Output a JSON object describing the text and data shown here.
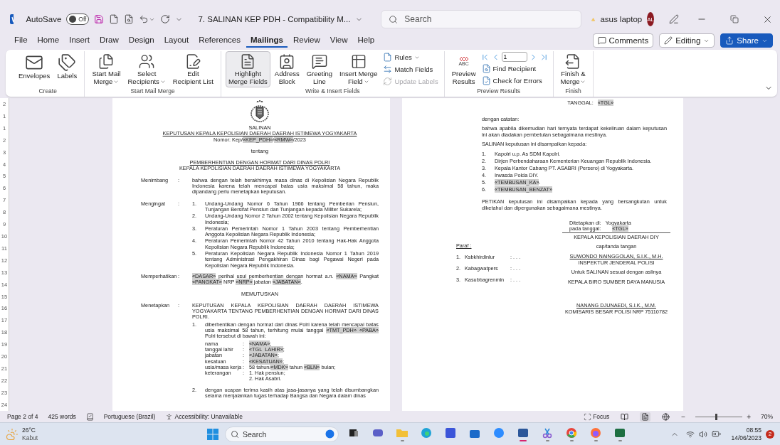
{
  "title_bar": {
    "autosave": {
      "label": "AutoSave",
      "state_label": "Off",
      "on": false
    },
    "document_title": "7. SALINAN KEP PDH  -  Compatibility M...",
    "search": {
      "placeholder": "Search"
    },
    "account": {
      "name": "asus laptop",
      "initials": "AL"
    }
  },
  "menu_tabs": [
    {
      "label": "File",
      "selected": false
    },
    {
      "label": "Home",
      "selected": false
    },
    {
      "label": "Insert",
      "selected": false
    },
    {
      "label": "Draw",
      "selected": false
    },
    {
      "label": "Design",
      "selected": false
    },
    {
      "label": "Layout",
      "selected": false
    },
    {
      "label": "References",
      "selected": false
    },
    {
      "label": "Mailings",
      "selected": true
    },
    {
      "label": "Review",
      "selected": false
    },
    {
      "label": "View",
      "selected": false
    },
    {
      "label": "Help",
      "selected": false
    }
  ],
  "header_buttons": [
    {
      "label": "Comments",
      "kind": "comments"
    },
    {
      "label": "Editing",
      "kind": "editing"
    },
    {
      "label": "Share",
      "kind": "share"
    }
  ],
  "ribbon": [
    {
      "group": "Create",
      "items": [
        {
          "kind": "large",
          "lines": [
            "Envelopes"
          ],
          "dropdown": false,
          "selected": false
        },
        {
          "kind": "large",
          "lines": [
            "Labels"
          ],
          "dropdown": false,
          "selected": false
        }
      ]
    },
    {
      "group": "Start Mail Merge",
      "items": [
        {
          "kind": "large",
          "lines": [
            "Start Mail",
            "Merge"
          ],
          "dropdown": true,
          "selected": false
        },
        {
          "kind": "large",
          "lines": [
            "Select",
            "Recipients"
          ],
          "dropdown": true,
          "selected": false
        },
        {
          "kind": "large",
          "lines": [
            "Edit",
            "Recipient List"
          ],
          "dropdown": false,
          "selected": false
        }
      ]
    },
    {
      "group": "Write & Insert Fields",
      "items": [
        {
          "kind": "large",
          "lines": [
            "Highlight",
            "Merge Fields"
          ],
          "dropdown": false,
          "selected": true
        },
        {
          "kind": "large",
          "lines": [
            "Address",
            "Block"
          ],
          "dropdown": false,
          "selected": false
        },
        {
          "kind": "large",
          "lines": [
            "Greeting",
            "Line"
          ],
          "dropdown": false,
          "selected": false
        },
        {
          "kind": "large",
          "lines": [
            "Insert Merge",
            "Field"
          ],
          "dropdown": true,
          "selected": false
        },
        {
          "kind": "stack",
          "items": [
            {
              "kind": "button",
              "label": "Rules",
              "dropdown": true,
              "disabled": false
            },
            {
              "kind": "button",
              "label": "Match Fields",
              "dropdown": false,
              "disabled": false
            },
            {
              "kind": "button",
              "label": "Update Labels",
              "dropdown": false,
              "disabled": true
            }
          ]
        }
      ]
    },
    {
      "group": "Preview Results",
      "items": [
        {
          "kind": "large",
          "lines": [
            "Preview",
            "Results"
          ],
          "icon_text": "ABC",
          "dropdown": false,
          "selected": false
        },
        {
          "kind": "stack",
          "items": [
            {
              "kind": "nav",
              "value": "1"
            },
            {
              "kind": "button",
              "label": "Find Recipient",
              "dropdown": false,
              "disabled": false
            },
            {
              "kind": "button",
              "label": "Check for Errors",
              "dropdown": false,
              "disabled": false
            }
          ]
        }
      ]
    },
    {
      "group": "Finish",
      "items": [
        {
          "kind": "large",
          "lines": [
            "Finish &",
            "Merge"
          ],
          "dropdown": true,
          "selected": false
        }
      ]
    }
  ],
  "ruler": [
    "2",
    "1",
    "1",
    "2",
    "3",
    "4",
    "5",
    "6",
    "7",
    "8",
    "9",
    "10",
    "11",
    "12",
    "13",
    "14",
    "15",
    "16",
    "17",
    "18",
    "19",
    "20",
    "21",
    "22",
    "23",
    "24"
  ],
  "left_page": {
    "title_groups": [
      [
        {
          "text": "SALINAN",
          "underline": false
        },
        {
          "text": "KEPUTUSAN KEPALA KEPOLISIAN DAERAH DAERAH ISTIMEWA YOGYAKARTA",
          "underline": true
        },
        {
          "runs": [
            {
              "text": "Nomor: Kep/",
              "field": false
            },
            {
              "text": "«KEP_PDH»",
              "field": true
            },
            {
              "text": "/",
              "field": false
            },
            {
              "text": "«RMW»",
              "field": true
            },
            {
              "text": "/2023",
              "field": false
            }
          ],
          "underline": false
        }
      ],
      [
        {
          "text": "tentang",
          "underline": false
        }
      ],
      [
        {
          "text": "PEMBERHENTIAN DENGAN HORMAT DARI DINAS POLRI",
          "underline": true
        },
        {
          "text": "KEPALA KEPOLISIAN DAERAH DAERAH ISTIMEWA YOGYAKARTA",
          "underline": false
        }
      ]
    ],
    "sections": [
      {
        "kind": "labeled",
        "label": "Menimbang",
        "colon": ":",
        "body": [
          {
            "kind": "para",
            "text": "bahwa dengan telah berakhirnya masa dinas di Kepolisian Negara Republik Indonesia karena telah mencapai batas usia maksimal 58 tahun, maka dipandang perlu menetapkan keputusan."
          }
        ]
      },
      {
        "kind": "labeled",
        "label": "Mengingat",
        "colon": ":",
        "body": [
          {
            "kind": "list",
            "items": [
              {
                "num": "1.",
                "text": "Undang-Undang Nomor 6 Tahun 1966 tentang Pemberian Pensiun, Tunjangan Bersifat Pensiun dan Tunjangan kepada Militer Sukarela;"
              },
              {
                "num": "2.",
                "text": "Undang-Undang Nomor 2 Tahun 2002 tentang Kepolisian Negara Republik Indonesia;"
              },
              {
                "num": "3.",
                "text": "Peraturan Pemerintah Nomor 1 Tahun 2003 tentang Pemberhentian Anggota Kepolisian Negara Republik Indonesia;"
              },
              {
                "num": "4.",
                "text": "Peraturan Pemerintah Nomor  42 Tahun 2010 tentang Hak-Hak Anggota Kepolisian Negara Republik Indonesia;"
              },
              {
                "num": "5.",
                "text": "Peraturan Kepolisian Negara Republik Indonesia Nomor  1 Tahun 2019 tentang Administrasi Pengakhiran Dinas bagi Pegawai Negeri pada Kepolisian Negara Republik Indonesia."
              }
            ]
          }
        ]
      },
      {
        "kind": "labeled",
        "label": "Memperhatikan",
        "colon": ":",
        "body": [
          {
            "kind": "para",
            "runs": [
              {
                "text": "«DASAR»",
                "field": true
              },
              {
                "text": " perihal usul pemberhentian dengan hormat a.n. ",
                "field": false
              },
              {
                "text": "«NAMA»",
                "field": true
              },
              {
                "text": " Pangkat ",
                "field": false
              },
              {
                "text": "«PANGKAT»",
                "field": true
              },
              {
                "text": " NRP ",
                "field": false
              },
              {
                "text": "«NRP»",
                "field": true
              },
              {
                "text": " jabatan ",
                "field": false
              },
              {
                "text": "«JABATAN»",
                "field": true
              },
              {
                "text": ".",
                "field": false
              }
            ]
          }
        ]
      },
      {
        "kind": "center",
        "text": "MEMUTUSKAN"
      },
      {
        "kind": "labeled",
        "label": "Menetapkan",
        "colon": ":",
        "body": [
          {
            "kind": "para",
            "text": "KEPUTUSAN KEPALA KEPOLISIAN DAERAH DAERAH ISTIMEWA YOGYAKARTA TENTANG PEMBERHENTIAN DENGAN HORMAT DARI DINAS POLRI."
          },
          {
            "kind": "list",
            "items": [
              {
                "num": "1.",
                "runs": [
                  {
                    "text": "diberhentikan dengan hormat dari dinas Polri karena telah mencapai batas usia maksimal 58 tahun, terhitung mulai tanggal ",
                    "field": false
                  },
                  {
                    "text": "«TMT_PDH»",
                    "field": true
                  },
                  {
                    "text": " «PABA»",
                    "field": true
                  },
                  {
                    "text": " Polri tersebut di bawah ini:",
                    "field": false
                  }
                ],
                "fields": [
                  {
                    "label": "nama",
                    "colon": ":",
                    "runs": [
                      {
                        "text": "«NAMA»",
                        "field": true
                      },
                      {
                        "text": ";",
                        "field": false
                      }
                    ]
                  },
                  {
                    "label": "tanggal lahir",
                    "colon": ":",
                    "runs": [
                      {
                        "text": "«TGL_LAHIR»",
                        "field": true
                      },
                      {
                        "text": ";",
                        "field": false
                      }
                    ]
                  },
                  {
                    "label": "jabatan",
                    "colon": ":",
                    "runs": [
                      {
                        "text": "«JABATAN»",
                        "field": true
                      },
                      {
                        "text": ";",
                        "field": false
                      }
                    ]
                  },
                  {
                    "label": "kesatuan",
                    "colon": ":",
                    "runs": [
                      {
                        "text": "«KESATUAN»",
                        "field": true
                      },
                      {
                        "text": ";",
                        "field": false
                      }
                    ]
                  },
                  {
                    "label": "usia/masa kerja",
                    "colon": ":",
                    "runs": [
                      {
                        "text": "58 tahun/",
                        "field": false
                      },
                      {
                        "text": "«MDK»",
                        "field": true
                      },
                      {
                        "text": " tahun ",
                        "field": false
                      },
                      {
                        "text": "«BLN»",
                        "field": true
                      },
                      {
                        "text": " bulan;",
                        "field": false
                      }
                    ]
                  },
                  {
                    "label": "keterangan",
                    "colon": ":",
                    "lines": [
                      "1. Hak pensiun;",
                      "2. Hak Asabri."
                    ]
                  }
                ]
              },
              {
                "num": "2.",
                "text": "dengan ucapan terima kasih atas jasa-jasanya yang telah disumbangkan selama menjalankan tugas terhadap Bangsa dan Negara dalam dinas"
              }
            ]
          }
        ]
      }
    ]
  },
  "right_page": {
    "blocks": [
      {
        "kind": "date",
        "label": "TANGGAL:",
        "runs": [
          {
            "text": "«TGL»",
            "field": true
          }
        ]
      },
      {
        "kind": "para",
        "text": "dengan catatan:"
      },
      {
        "kind": "para",
        "text": "bahwa apabila dikemudian hari ternyata terdapat kekeliruan dalam keputusan ini akan diadakan pembetulan sebagaimana mestinya."
      },
      {
        "kind": "para",
        "text": "SALINAN keputusan ini disampaikan kepada:"
      },
      {
        "kind": "list",
        "items": [
          {
            "num": "1.",
            "text": "Kapolri u.p. As SDM Kapolri."
          },
          {
            "num": "2.",
            "text": "Dirjen Perbendaharaan Kementerian Keuangan Republik Indonesia."
          },
          {
            "num": "3.",
            "text": "Kepala Kantor Cabang PT. ASABRI (Persero) di Yogyakarta."
          },
          {
            "num": "4.",
            "text": "Irwasda Polda DIY."
          },
          {
            "num": "5.",
            "runs": [
              {
                "text": "«TEMBUSAN_KA»",
                "field": true
              },
              {
                "text": ".",
                "field": false
              }
            ]
          },
          {
            "num": "6.",
            "runs": [
              {
                "text": "«TEMBUSAN_BENZAT»",
                "field": true
              }
            ]
          }
        ]
      },
      {
        "kind": "para",
        "text": "PETIKAN keputusan ini disampaikan kepada yang bersangkutan untuk diketahui dan dipergunakan sebagaimana mestinya."
      },
      {
        "kind": "signature",
        "paraf": {
          "title": "Paraf :",
          "items": [
            {
              "num": "1.",
              "role": "Ksbkhirdinlur",
              "value": ": . . ."
            },
            {
              "num": "2.",
              "role": "Kabagwatpers",
              "value": ": . . ."
            },
            {
              "num": "3.",
              "role": "Kasubbagrenmin",
              "value": ": . . ."
            }
          ]
        },
        "place": {
          "label": "Ditetapkan di:",
          "value": "Yogyakarta"
        },
        "date": {
          "label": "pada tanggal:",
          "runs": [
            {
              "text": "«TGL»",
              "field": true
            }
          ]
        },
        "groups": [
          [
            {
              "text": "KEPALA KEPOLISIAN DAERAH DIY",
              "underline": false
            }
          ],
          [
            {
              "text": "cap/tanda tangan",
              "underline": false
            }
          ],
          [
            {
              "text": "SUWONDO NAINGGOLAN, S.I.K., M.H.",
              "underline": true
            },
            {
              "text": "INSPEKTUR JENDERAL POLISI",
              "underline": false
            }
          ],
          [
            {
              "text": "Untuk SALINAN sesuai dengan aslinya",
              "underline": false
            }
          ],
          [
            {
              "text": "KEPALA BIRO SUMBER DAYA MANUSIA",
              "underline": false
            }
          ],
          [
            {
              "text": "NANANG DJUNAEDI, S.I.K., M.M.",
              "underline": true
            },
            {
              "text": "KOMISARIS BESAR POLISI NRP 75110782",
              "underline": false
            }
          ]
        ]
      }
    ]
  },
  "status_bar": {
    "page": "Page 2 of 4",
    "words": "425 words",
    "language": "Portuguese (Brazil)",
    "accessibility": "Accessibility: Unavailable",
    "focus": "Focus",
    "views": [
      {
        "kind": "read",
        "selected": false
      },
      {
        "kind": "print",
        "selected": true
      },
      {
        "kind": "web",
        "selected": false
      }
    ],
    "zoom": {
      "minus": "−",
      "plus": "+",
      "level": 0.42,
      "label": "70%"
    }
  },
  "taskbar": {
    "weather": {
      "temp": "26°C",
      "condition": "Kabut"
    },
    "search": {
      "placeholder": "Search"
    },
    "apps": [
      {
        "kind": "task-view",
        "running": false,
        "active": false
      },
      {
        "kind": "meet",
        "running": false,
        "active": false
      },
      {
        "kind": "explorer",
        "running": true,
        "active": false
      },
      {
        "kind": "edge",
        "running": false,
        "active": false
      },
      {
        "kind": "blue-app",
        "running": false,
        "active": false
      },
      {
        "kind": "store",
        "running": false,
        "active": false
      },
      {
        "kind": "zoom",
        "running": false,
        "active": false
      },
      {
        "kind": "word",
        "running": true,
        "active": true
      },
      {
        "kind": "snip",
        "running": true,
        "active": false
      },
      {
        "kind": "chrome",
        "running": true,
        "active": false
      },
      {
        "kind": "firefox",
        "running": true,
        "active": false
      },
      {
        "kind": "excel",
        "running": true,
        "active": false
      }
    ],
    "time": "08:55",
    "date": "14/06/2023",
    "notifications": "2"
  }
}
